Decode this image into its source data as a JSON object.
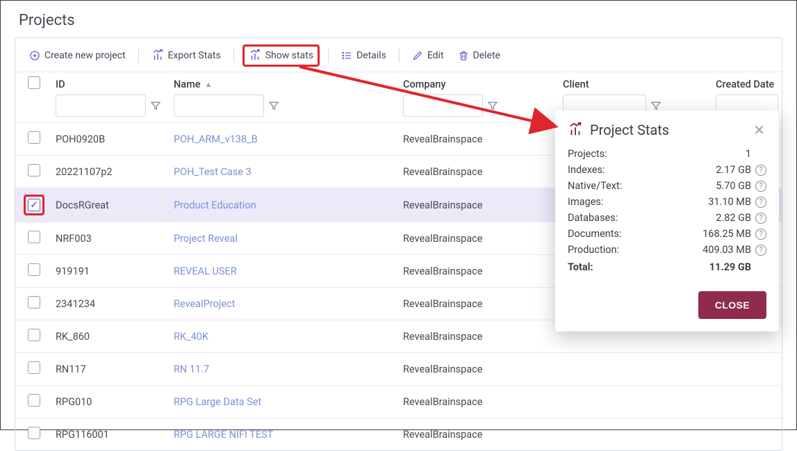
{
  "page": {
    "title": "Projects"
  },
  "toolbar": {
    "create": "Create new project",
    "export": "Export Stats",
    "show_stats": "Show stats",
    "details": "Details",
    "edit": "Edit",
    "delete": "Delete"
  },
  "columns": {
    "id": "ID",
    "name": "Name",
    "company": "Company",
    "client": "Client",
    "created": "Created Date"
  },
  "rows": [
    {
      "checked": false,
      "id": "POH0920B",
      "name": "POH_ARM_v138_B",
      "company": "RevealBrainspace"
    },
    {
      "checked": false,
      "id": "20221107p2",
      "name": "POH_Test Case 3",
      "company": "RevealBrainspace"
    },
    {
      "checked": true,
      "id": "DocsRGreat",
      "name": "Product Education",
      "company": "RevealBrainspace"
    },
    {
      "checked": false,
      "id": "NRF003",
      "name": "Project Reveal",
      "company": "RevealBrainspace"
    },
    {
      "checked": false,
      "id": "919191",
      "name": "REVEAL USER",
      "company": "RevealBrainspace"
    },
    {
      "checked": false,
      "id": "2341234",
      "name": "RevealProject",
      "company": "RevealBrainspace"
    },
    {
      "checked": false,
      "id": "RK_860",
      "name": "RK_40K",
      "company": "RevealBrainspace"
    },
    {
      "checked": false,
      "id": "RN117",
      "name": "RN 11.7",
      "company": "RevealBrainspace"
    },
    {
      "checked": false,
      "id": "RPG010",
      "name": "RPG Large Data Set",
      "company": "RevealBrainspace"
    },
    {
      "checked": false,
      "id": "RPG116001",
      "name": "RPG LARGE NIFI TEST",
      "company": "RevealBrainspace"
    }
  ],
  "stats": {
    "title": "Project Stats",
    "rows": [
      {
        "label": "Projects:",
        "value": "1",
        "help": false
      },
      {
        "label": "Indexes:",
        "value": "2.17 GB",
        "help": true
      },
      {
        "label": "Native/Text:",
        "value": "5.70 GB",
        "help": true
      },
      {
        "label": "Images:",
        "value": "31.10 MB",
        "help": true
      },
      {
        "label": "Databases:",
        "value": "2.82 GB",
        "help": true
      },
      {
        "label": "Documents:",
        "value": "168.25 MB",
        "help": true
      },
      {
        "label": "Production:",
        "value": "409.03 MB",
        "help": true
      }
    ],
    "total_label": "Total:",
    "total_value": "11.29 GB",
    "close": "CLOSE"
  }
}
